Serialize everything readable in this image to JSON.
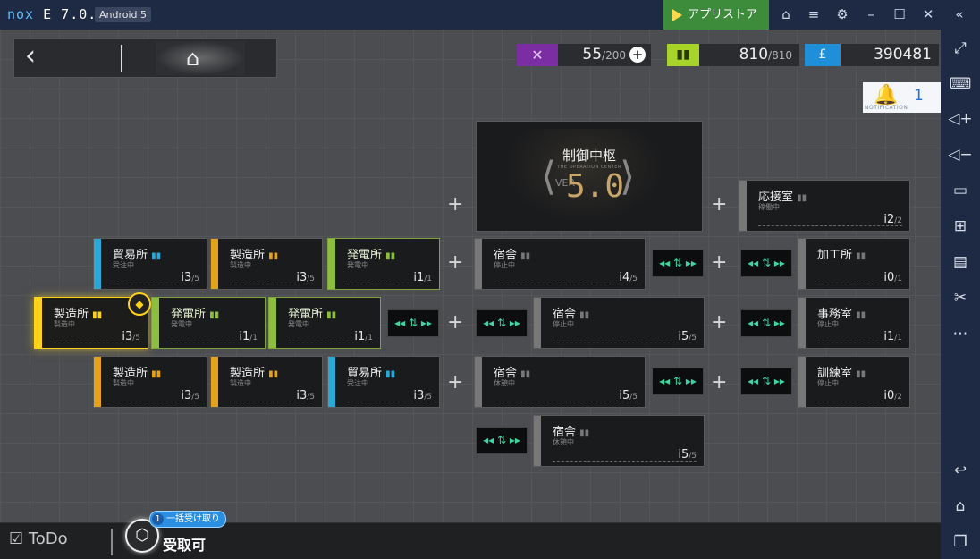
{
  "emulator": {
    "logo_left": "nox",
    "logo_right": "E 7.0.0.",
    "android_badge": "Android 5",
    "store_label": "アプリストア",
    "title_icons": [
      "shirt-icon",
      "menu-icon",
      "gear-icon",
      "minimize-icon",
      "maximize-icon",
      "close-icon",
      "collapse-icon"
    ],
    "sidebar_icons": [
      "fullscreen-icon",
      "keyboard-icon",
      "volume-up-icon",
      "volume-down-icon",
      "screen-icon",
      "apk-install-icon",
      "toolbox-icon",
      "scissors-icon",
      "more-icon",
      "back-nav-icon",
      "home-nav-icon",
      "recent-apps-icon"
    ]
  },
  "hud": {
    "drones": {
      "value": "55",
      "max": "/200"
    },
    "energy": {
      "value": "810",
      "max": "/810"
    },
    "currency": {
      "value": "390481"
    },
    "notification": {
      "count": "1",
      "caption": "NOTIFICATION"
    }
  },
  "control_center": {
    "title": "制御中枢",
    "subtitle": "THE OPERATION CENTER",
    "ver_label": "VER",
    "version": "5.0"
  },
  "facilities": [
    {
      "id": "reception",
      "name": "応接室",
      "status": "稼働中",
      "level": "2",
      "max": "/2",
      "color": "#777777"
    },
    {
      "id": "trade-1",
      "name": "貿易所",
      "status": "受注中",
      "level": "3",
      "max": "/5",
      "color": "#2aa9d6"
    },
    {
      "id": "factory-1",
      "name": "製造所",
      "status": "製造中",
      "level": "3",
      "max": "/5",
      "color": "#e3a21a"
    },
    {
      "id": "power-1",
      "name": "発電所",
      "status": "発電中",
      "level": "1",
      "max": "/1",
      "color": "#8cbf3f"
    },
    {
      "id": "dorm-1",
      "name": "宿舎",
      "status": "停止中",
      "level": "4",
      "max": "/5",
      "color": "#777777"
    },
    {
      "id": "workshop",
      "name": "加工所",
      "status": "",
      "level": "0",
      "max": "/1",
      "color": "#777777"
    },
    {
      "id": "factory-hl",
      "name": "製造所",
      "status": "製造中",
      "level": "3",
      "max": "/5",
      "color": "#ffd21a"
    },
    {
      "id": "power-2",
      "name": "発電所",
      "status": "発電中",
      "level": "1",
      "max": "/1",
      "color": "#8cbf3f"
    },
    {
      "id": "power-3",
      "name": "発電所",
      "status": "発電中",
      "level": "1",
      "max": "/1",
      "color": "#8cbf3f"
    },
    {
      "id": "dorm-2",
      "name": "宿舎",
      "status": "停止中",
      "level": "5",
      "max": "/5",
      "color": "#777777"
    },
    {
      "id": "office",
      "name": "事務室",
      "status": "停止中",
      "level": "1",
      "max": "/1",
      "color": "#777777"
    },
    {
      "id": "factory-2",
      "name": "製造所",
      "status": "製造中",
      "level": "3",
      "max": "/5",
      "color": "#e3a21a"
    },
    {
      "id": "factory-3",
      "name": "製造所",
      "status": "製造中",
      "level": "3",
      "max": "/5",
      "color": "#e3a21a"
    },
    {
      "id": "trade-2",
      "name": "貿易所",
      "status": "受注中",
      "level": "3",
      "max": "/5",
      "color": "#2aa9d6"
    },
    {
      "id": "dorm-3",
      "name": "宿舎",
      "status": "休憩中",
      "level": "5",
      "max": "/5",
      "color": "#777777"
    },
    {
      "id": "training",
      "name": "訓練室",
      "status": "停止中",
      "level": "0",
      "max": "/2",
      "color": "#777777"
    },
    {
      "id": "dorm-4",
      "name": "宿舎",
      "status": "休憩中",
      "level": "5",
      "max": "/5",
      "color": "#777777"
    }
  ],
  "bottom": {
    "todo_label": "ToDo",
    "claim_count": "1",
    "claim_all_label": "一括受け取り",
    "claim_label": "受取可"
  }
}
